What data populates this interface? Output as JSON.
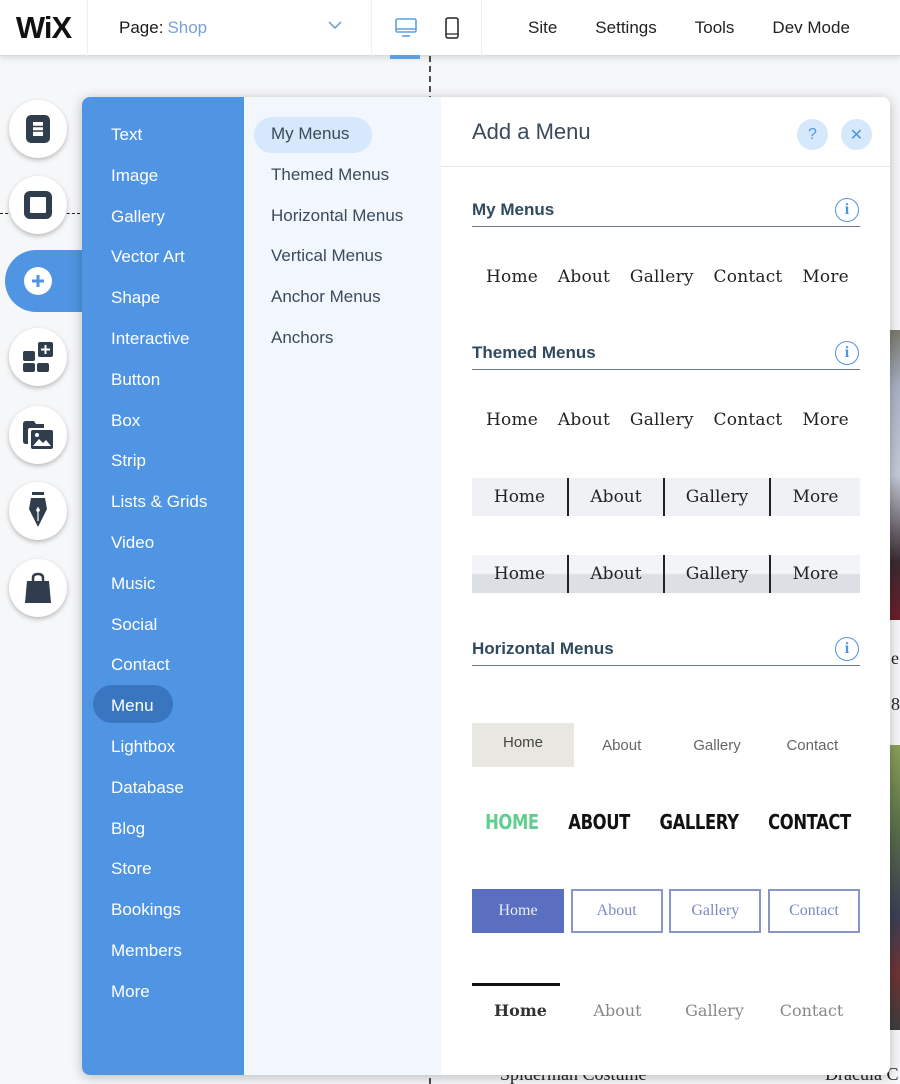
{
  "topbar": {
    "logo": "WiX",
    "page_label": "Page:",
    "page_name": "Shop",
    "devices": [
      {
        "name": "desktop",
        "icon": "desktop-icon",
        "active": true
      },
      {
        "name": "mobile",
        "icon": "mobile-icon",
        "active": false
      }
    ],
    "menu": [
      "Site",
      "Settings",
      "Tools",
      "Dev Mode"
    ]
  },
  "rail": [
    {
      "name": "pages",
      "icon": "pages-icon"
    },
    {
      "name": "background",
      "icon": "background-icon"
    },
    {
      "name": "add",
      "icon": "plus-icon",
      "active": true
    },
    {
      "name": "add-apps",
      "icon": "apps-icon"
    },
    {
      "name": "media",
      "icon": "media-icon"
    },
    {
      "name": "blog",
      "icon": "pen-icon"
    },
    {
      "name": "store",
      "icon": "bag-icon"
    }
  ],
  "categories": [
    "Text",
    "Image",
    "Gallery",
    "Vector Art",
    "Shape",
    "Interactive",
    "Button",
    "Box",
    "Strip",
    "Lists & Grids",
    "Video",
    "Music",
    "Social",
    "Contact",
    "Menu",
    "Lightbox",
    "Database",
    "Blog",
    "Store",
    "Bookings",
    "Members",
    "More"
  ],
  "selected_category": "Menu",
  "subcategories": [
    "My Menus",
    "Themed Menus",
    "Horizontal Menus",
    "Vertical Menus",
    "Anchor Menus",
    "Anchors"
  ],
  "selected_subcategory": "My Menus",
  "panel": {
    "title": "Add a Menu",
    "help_label": "?",
    "close_label": "✕",
    "sections": {
      "my_menus": {
        "title": "My Menus",
        "items": [
          "Home",
          "About",
          "Gallery",
          "Contact",
          "More"
        ]
      },
      "themed_menus": {
        "title": "Themed Menus",
        "plain": [
          "Home",
          "About",
          "Gallery",
          "Contact",
          "More"
        ],
        "boxed": [
          "Home",
          "About",
          "Gallery",
          "More"
        ],
        "gradient": [
          "Home",
          "About",
          "Gallery",
          "More"
        ]
      },
      "horizontal_menus": {
        "title": "Horizontal Menus",
        "flat": [
          "Home",
          "About",
          "Gallery",
          "Contact"
        ],
        "bold": [
          "HOME",
          "ABOUT",
          "GALLERY",
          "CONTACT"
        ],
        "buttons": [
          "Home",
          "About",
          "Gallery",
          "Contact"
        ],
        "underline": [
          "Home",
          "About",
          "Gallery",
          "Contact"
        ]
      }
    },
    "info_glyph": "i"
  },
  "site_bg": {
    "texts": [
      "e",
      "8",
      "Spiderman Costume",
      "Dracula C"
    ]
  },
  "colors": {
    "accent": "#4f95e3",
    "accent_dark": "#3a75c0",
    "sub_bg": "#f2f7fe",
    "green": "#5fce8e",
    "button_blue": "#5a6fbf"
  }
}
